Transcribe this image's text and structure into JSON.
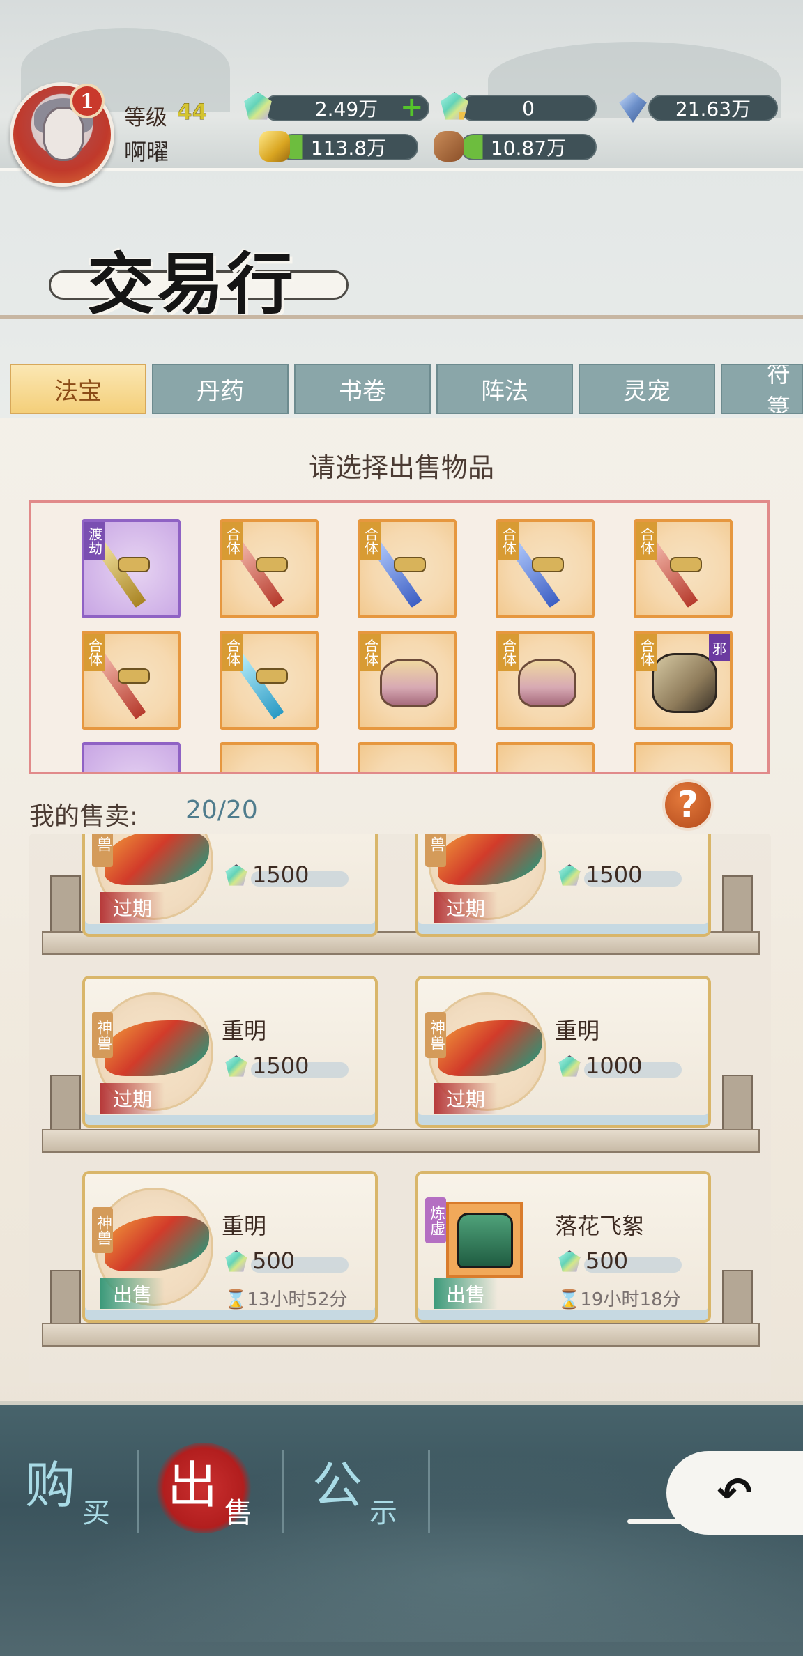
{
  "player": {
    "rank": "1",
    "level_label": "等级",
    "level_value": "44",
    "name": "啊曜"
  },
  "resources": [
    {
      "icon": "spirit-gem-icon",
      "value": "2.49万",
      "has_plus": true
    },
    {
      "icon": "bound-spirit-gem-icon",
      "value": "0"
    },
    {
      "icon": "blue-crystal-icon",
      "value": "21.63万"
    },
    {
      "icon": "gold-ingot-icon",
      "value": "113.8万"
    },
    {
      "icon": "wood-log-icon",
      "value": "10.87万"
    }
  ],
  "page_title": "交易行",
  "tabs": [
    {
      "label": "法宝",
      "active": true
    },
    {
      "label": "丹药"
    },
    {
      "label": "书卷"
    },
    {
      "label": "阵法"
    },
    {
      "label": "灵宠"
    },
    {
      "label": "符箓"
    }
  ],
  "select_prompt": "请选择出售物品",
  "inventory": [
    {
      "tier": "渡劫",
      "type": "gold-spear-icon",
      "rarity": "purple"
    },
    {
      "tier": "合体",
      "type": "red-spear-icon"
    },
    {
      "tier": "合体",
      "type": "blue-sword-icon"
    },
    {
      "tier": "合体",
      "type": "blue-sword-icon"
    },
    {
      "tier": "合体",
      "type": "red-spear-icon"
    },
    {
      "tier": "合体",
      "type": "red-spear-icon"
    },
    {
      "tier": "合体",
      "type": "cyan-spear-icon"
    },
    {
      "tier": "合体",
      "type": "crown-helm-icon"
    },
    {
      "tier": "合体",
      "type": "crown-helm-icon"
    },
    {
      "tier": "合体",
      "type": "dark-armor-icon",
      "mark": "邪"
    }
  ],
  "my_sales": {
    "label": "我的售卖:",
    "count": "20/20"
  },
  "listings": [
    {
      "badge": "兽",
      "name": "",
      "price": "1500",
      "status": "过期",
      "status_kind": "expired"
    },
    {
      "badge": "兽",
      "name": "",
      "price": "1500",
      "status": "过期",
      "status_kind": "expired"
    },
    {
      "badge": "神兽",
      "name": "重明",
      "price": "1500",
      "status": "过期",
      "status_kind": "expired"
    },
    {
      "badge": "神兽",
      "name": "重明",
      "price": "1000",
      "status": "过期",
      "status_kind": "expired"
    },
    {
      "badge": "神兽",
      "name": "重明",
      "price": "500",
      "status": "出售",
      "status_kind": "selling",
      "timer": "⌛13小时52分"
    },
    {
      "badge": "炼虚",
      "name": "落花飞絮",
      "price": "500",
      "status": "出售",
      "status_kind": "selling",
      "timer": "⌛19小时18分",
      "kind": "armor"
    }
  ],
  "bottom_nav": [
    {
      "big": "购",
      "small": "买"
    },
    {
      "big": "出",
      "small": "售",
      "active": true
    },
    {
      "big": "公",
      "small": "示"
    }
  ],
  "back_symbol": "↶"
}
